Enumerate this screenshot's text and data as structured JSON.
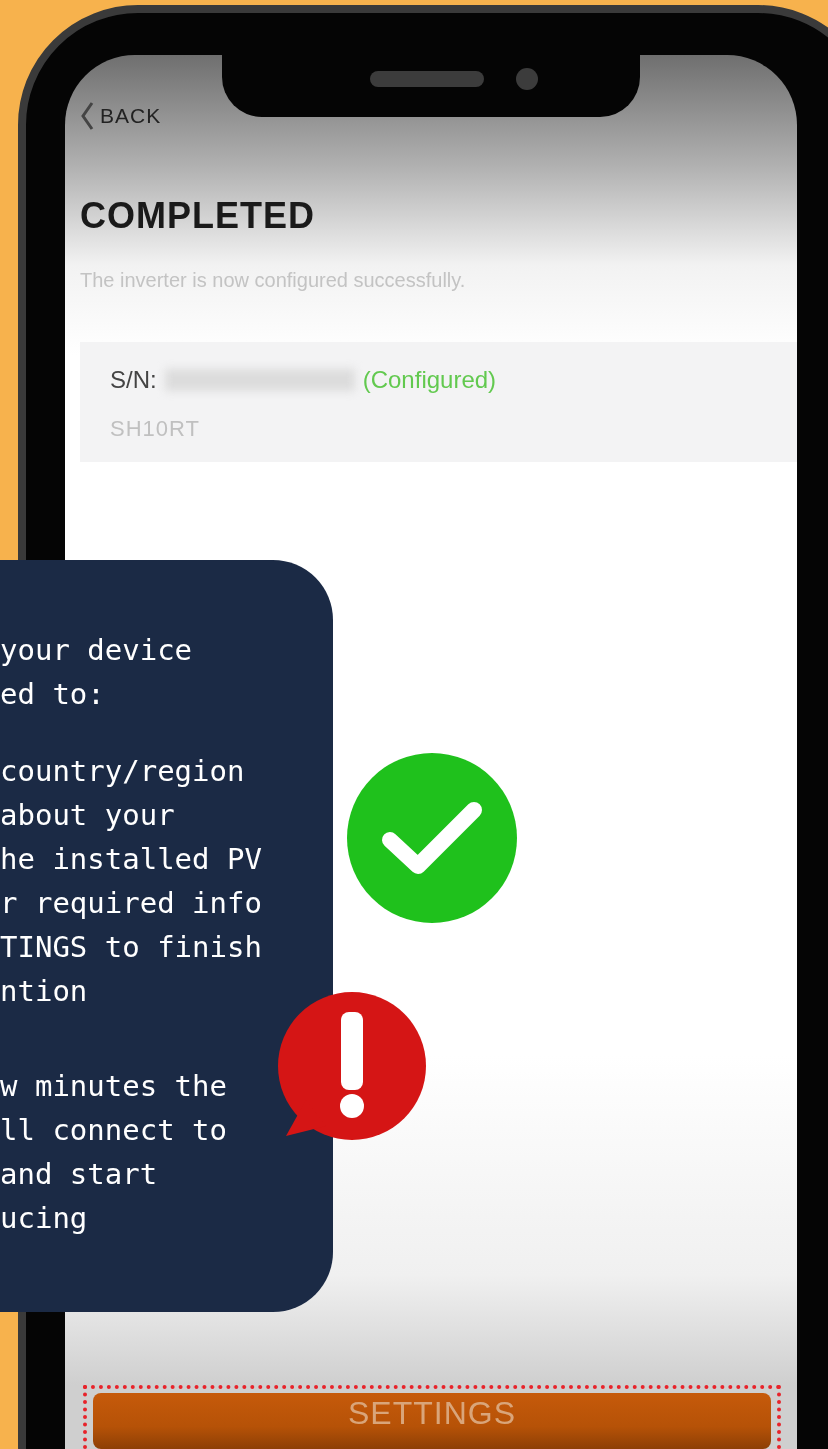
{
  "back": "BACK",
  "title": "COMPLETED",
  "subtitle": "The inverter is now configured successfully.",
  "device": {
    "sn_label": "S/N:",
    "status": "(Configured)",
    "model": "SH10RT"
  },
  "callout": {
    "paragraphs": [
      [
        "your device",
        "ed to:"
      ],
      [
        "country/region",
        "about your",
        "he installed PV",
        "r required info",
        "TINGS to finish",
        "ntion"
      ],
      [
        "w minutes the",
        "ll connect to",
        "and start",
        "ucing"
      ]
    ]
  },
  "button": {
    "label": "SETTINGS",
    "highlighted": true
  }
}
